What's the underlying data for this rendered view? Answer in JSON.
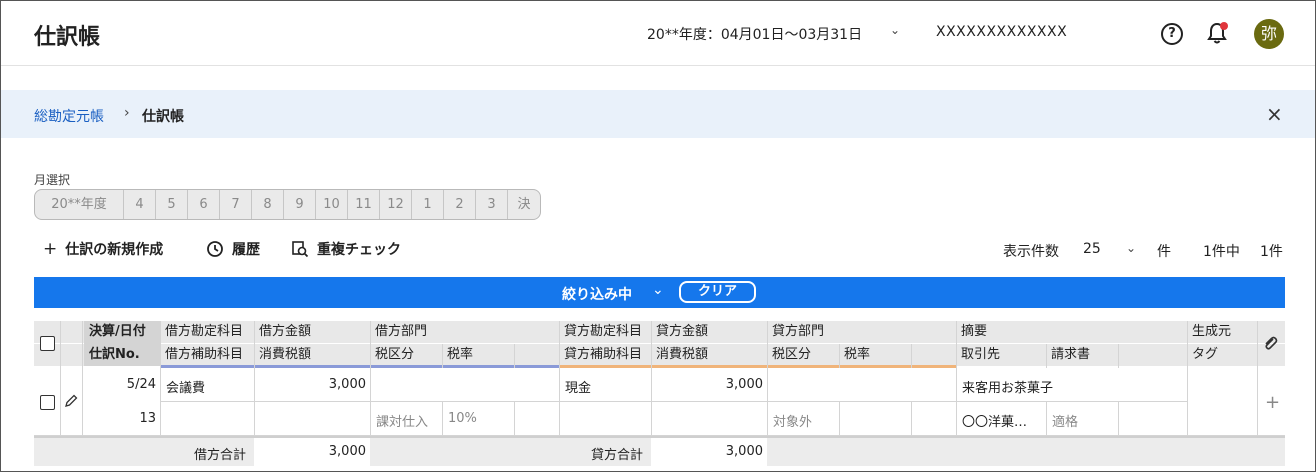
{
  "header": {
    "title": "仕訳帳",
    "period": "20**年度：04月01日〜03月31日",
    "company": "XXXXXXXXXXXXX",
    "avatar_text": "弥",
    "icons": [
      "help-icon",
      "bell-icon",
      "chevron-down-icon"
    ]
  },
  "breadcrumb": {
    "parent": "総勘定元帳",
    "separator": "›",
    "current": "仕訳帳",
    "close": "×"
  },
  "month_selector": {
    "label": "月選択",
    "options": [
      "20**年度",
      "4",
      "5",
      "6",
      "7",
      "8",
      "9",
      "10",
      "11",
      "12",
      "1",
      "2",
      "3",
      "決"
    ]
  },
  "toolbar": {
    "new_entry": "仕訳の新規作成",
    "history": "履歴",
    "duplicate_check": "重複チェック",
    "per_page_label": "表示件数",
    "per_page_value": "25",
    "per_page_unit": "件",
    "count_text": "1件中",
    "count_total": "1件"
  },
  "filter": {
    "label": "絞り込み中",
    "clear": "クリア",
    "bar_color": "#1577ec"
  },
  "table": {
    "headers_top": {
      "date": "決算/日付",
      "debit_account": "借方勘定科目",
      "debit_amount": "借方金額",
      "debit_dept": "借方部門",
      "credit_account": "貸方勘定科目",
      "credit_amount": "貸方金額",
      "credit_dept": "貸方部門",
      "memo": "摘要",
      "source": "生成元"
    },
    "headers_bottom": {
      "entry_no": "仕訳No.",
      "debit_sub": "借方補助科目",
      "debit_tax": "消費税額",
      "debit_tax_class": "税区分",
      "debit_tax_rate": "税率",
      "credit_sub": "貸方補助科目",
      "credit_tax": "消費税額",
      "credit_tax_class": "税区分",
      "credit_tax_rate": "税率",
      "partner": "取引先",
      "invoice": "請求書",
      "tag": "タグ"
    },
    "row": {
      "date": "5/24",
      "no": "13",
      "debit_account": "会議費",
      "debit_amount": "3,000",
      "debit_tax_class": "課対仕入",
      "debit_tax_rate": "10%",
      "credit_account": "現金",
      "credit_amount": "3,000",
      "credit_tax_class": "対象外",
      "memo": "来客用お茶菓子",
      "partner": "〇〇洋菓…",
      "invoice": "適格"
    },
    "totals": {
      "debit_label": "借方合計",
      "debit_total": "3,000",
      "credit_label": "貸方合計",
      "credit_total": "3,000"
    },
    "accent_debit": "#8a9ad8",
    "accent_credit": "#f0b47a"
  }
}
